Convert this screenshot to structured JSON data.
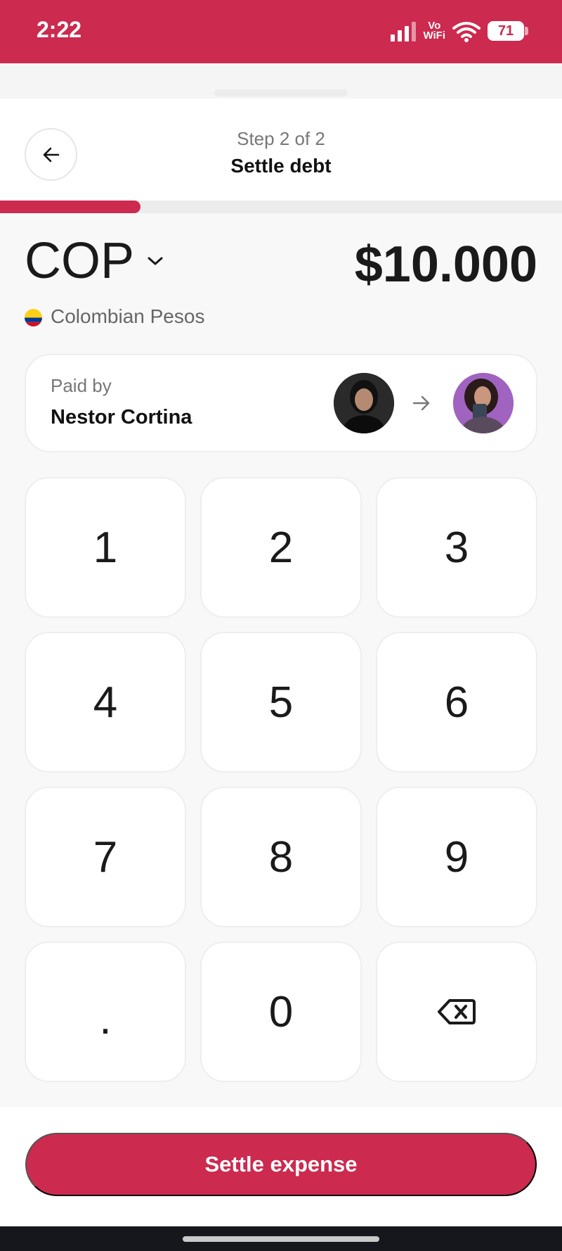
{
  "status_bar": {
    "time": "2:22",
    "network_line1": "Vo",
    "network_line2": "WiFi",
    "battery": "71"
  },
  "header": {
    "step": "Step 2 of 2",
    "title": "Settle debt",
    "progress": 0.25
  },
  "currency": {
    "code": "COP",
    "name": "Colombian Pesos",
    "flag_colors": [
      "#fcd116",
      "#003893",
      "#ce1126"
    ]
  },
  "amount": "$10.000",
  "payer": {
    "label": "Paid by",
    "name": "Nestor Cortina"
  },
  "keypad": {
    "keys": [
      "1",
      "2",
      "3",
      "4",
      "5",
      "6",
      "7",
      "8",
      "9",
      ".",
      "0"
    ]
  },
  "actions": {
    "settle_label": "Settle expense"
  },
  "colors": {
    "accent": "#cc2a4f",
    "background": "#f8f8f8"
  }
}
